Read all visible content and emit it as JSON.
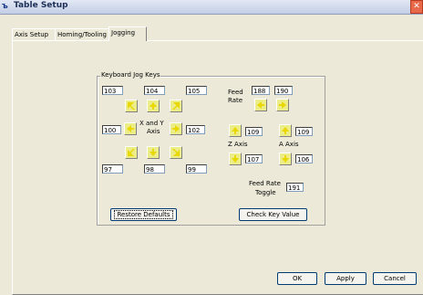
{
  "window": {
    "title": "Table Setup"
  },
  "tabs": [
    {
      "label": "Axis Setup"
    },
    {
      "label": "Homing/Tooling"
    },
    {
      "label": "Jogging"
    }
  ],
  "group": {
    "label": "Keyboard Jog Keys",
    "keys": {
      "up_left": "103",
      "up": "104",
      "up_right": "105",
      "left": "100",
      "right": "102",
      "down_left": "97",
      "down": "98",
      "down_right": "99",
      "feed_minus": "188",
      "feed_plus": "190",
      "z_up": "109",
      "z_down": "107",
      "a_up": "109",
      "a_down": "106",
      "feed_toggle": "191"
    },
    "labels": {
      "xy_axis_line1": "X and Y",
      "xy_axis_line2": "Axis",
      "feed": "Feed",
      "rate": "Rate",
      "z_axis": "Z Axis",
      "a_axis": "A Axis",
      "feed_rate": "Feed Rate",
      "toggle": "Toggle"
    },
    "restore_defaults": "Restore Defaults",
    "check_key_value": "Check Key Value"
  },
  "footer": {
    "ok": "OK",
    "apply": "Apply",
    "cancel": "Cancel"
  }
}
